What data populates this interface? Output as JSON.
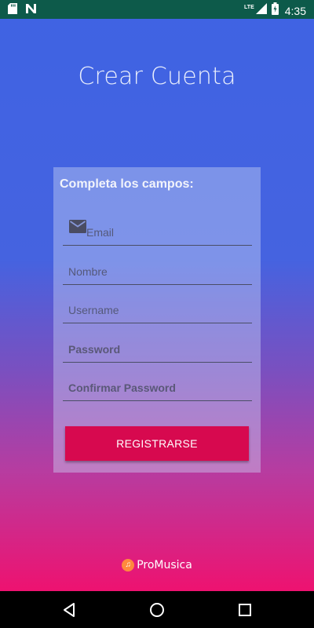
{
  "status_bar": {
    "time": "4:35",
    "network": "LTE",
    "icons": [
      "sd-card-icon",
      "n-icon",
      "lte-signal-icon",
      "battery-icon"
    ]
  },
  "header": {
    "title": "Crear Cuenta"
  },
  "form": {
    "heading": "Completa los campos:",
    "fields": [
      {
        "placeholder": "Email",
        "icon": "mail-icon"
      },
      {
        "placeholder": "Nombre"
      },
      {
        "placeholder": "Username"
      },
      {
        "placeholder": "Password"
      },
      {
        "placeholder": "Confirmar Password"
      }
    ],
    "submit_label": "REGISTRARSE"
  },
  "footer": {
    "brand": "ProMusica",
    "brand_icon": "music-note-icon"
  },
  "nav": {
    "buttons": [
      "back-icon",
      "home-icon",
      "recents-icon"
    ]
  },
  "colors": {
    "status_bar": "#0d5a4a",
    "accent": "#d7094f",
    "gradient_top": "#3f63e3",
    "gradient_bottom": "#ee1270"
  }
}
